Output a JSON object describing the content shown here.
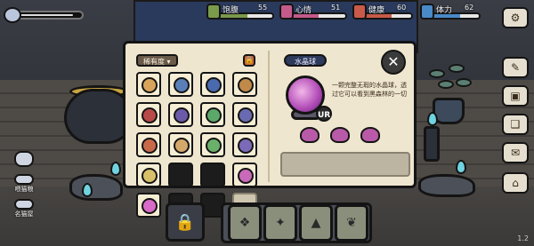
{
  "hud": {
    "stats": [
      {
        "name": "饱腹",
        "value": "55",
        "color": "#7a9a4c",
        "fill": 0.55
      },
      {
        "name": "心情",
        "value": "51",
        "color": "#c45a8c",
        "fill": 0.51
      },
      {
        "name": "健康",
        "value": "60",
        "color": "#c85a4a",
        "fill": 0.6
      },
      {
        "name": "体力",
        "value": "62",
        "color": "#4a8ac8",
        "fill": 0.62
      }
    ]
  },
  "left_buttons": [
    {
      "label": ""
    },
    {
      "label": "喂猫粮"
    },
    {
      "label": "名猫屋"
    }
  ],
  "collection": {
    "tab_label": "稀有度",
    "cell_badges": [
      "",
      "",
      "",
      "",
      "",
      "",
      "",
      "",
      "",
      "",
      "",
      "",
      "",
      "",
      "",
      "",
      "",
      "",
      "",
      ""
    ],
    "cells": [
      {
        "state": "item",
        "color": "#d8a45c"
      },
      {
        "state": "item",
        "color": "#5a7fb8"
      },
      {
        "state": "item",
        "color": "#4a6ab0"
      },
      {
        "state": "item",
        "color": "#c08a4a"
      },
      {
        "state": "item",
        "color": "#b84a4a"
      },
      {
        "state": "item",
        "color": "#6a5aa8"
      },
      {
        "state": "item",
        "color": "#5ca86a"
      },
      {
        "state": "item",
        "color": "#6a6ab0"
      },
      {
        "state": "item",
        "color": "#c86a4a"
      },
      {
        "state": "item",
        "color": "#d4a86a"
      },
      {
        "state": "item",
        "color": "#6ab06a"
      },
      {
        "state": "item",
        "color": "#7a6ab8"
      },
      {
        "state": "item",
        "color": "#d8c06a"
      },
      {
        "state": "locked",
        "color": "#1c1c1c"
      },
      {
        "state": "locked",
        "color": "#1c1c1c"
      },
      {
        "state": "item",
        "color": "#c86ab8"
      },
      {
        "state": "item",
        "color": "#d86ac8"
      },
      {
        "state": "locked",
        "color": "#1c1c1c"
      },
      {
        "state": "locked",
        "color": "#1c1c1c"
      },
      {
        "state": "empty",
        "color": "#cfc6b0"
      }
    ]
  },
  "detail": {
    "item_name": "水晶球",
    "rarity": "UR",
    "description": "一颗完整无瑕的水晶球，透过它可以看到黑森林的一切"
  },
  "version": "1.2"
}
